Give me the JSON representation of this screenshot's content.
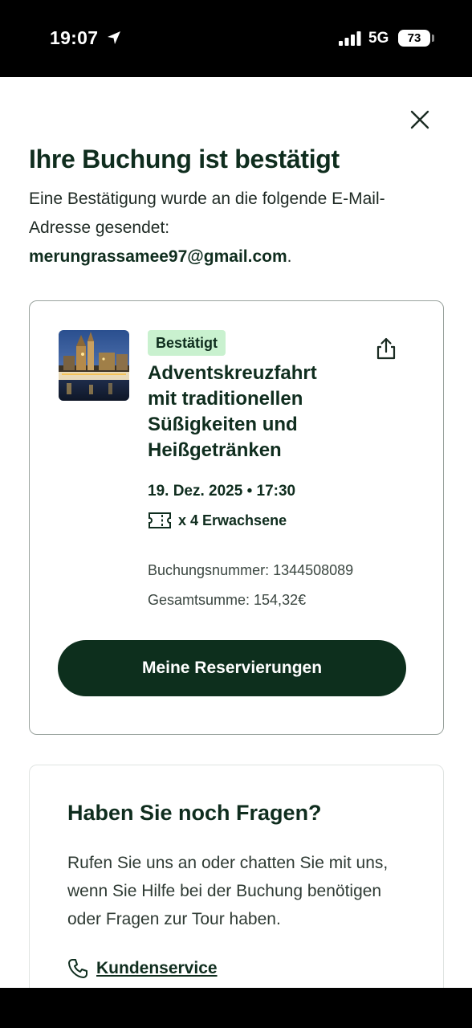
{
  "status_bar": {
    "time": "19:07",
    "network": "5G",
    "battery": "73",
    "icons": [
      "location-arrow-icon",
      "signal-bars-icon",
      "battery-icon"
    ]
  },
  "header": {
    "close_icon": "close-icon"
  },
  "confirmation": {
    "title": "Ihre Buchung ist bestätigt",
    "intro_text": "Eine Bestätigung wurde an die folgende E-Mail-Adresse gesendet:",
    "email": "merungrassamee97@gmail.com",
    "email_suffix": "."
  },
  "booking_card": {
    "status_badge": "Bestätigt",
    "tour_title": "Adventskreuzfahrt mit traditionellen Süßigkeiten und Heißgetränken",
    "date_time": "19. Dez. 2025 • 17:30",
    "tickets": "x 4 Erwachsene",
    "booking_number": "Buchungsnummer: 1344508089",
    "total": "Gesamtsumme: 154,32€",
    "button_label": "Meine Reservierungen",
    "share_icon": "share-icon",
    "ticket_icon": "ticket-icon"
  },
  "help_card": {
    "title": "Haben Sie noch Fragen?",
    "text": "Rufen Sie uns an oder chatten Sie mit uns, wenn Sie Hilfe bei der Buchung benötigen oder Fragen zur Tour haben.",
    "link_label": "Kundenservice",
    "link_icon": "phone-icon"
  },
  "colors": {
    "brand_dark_green": "#0d2f1d",
    "badge_green": "#c9f1cf"
  }
}
